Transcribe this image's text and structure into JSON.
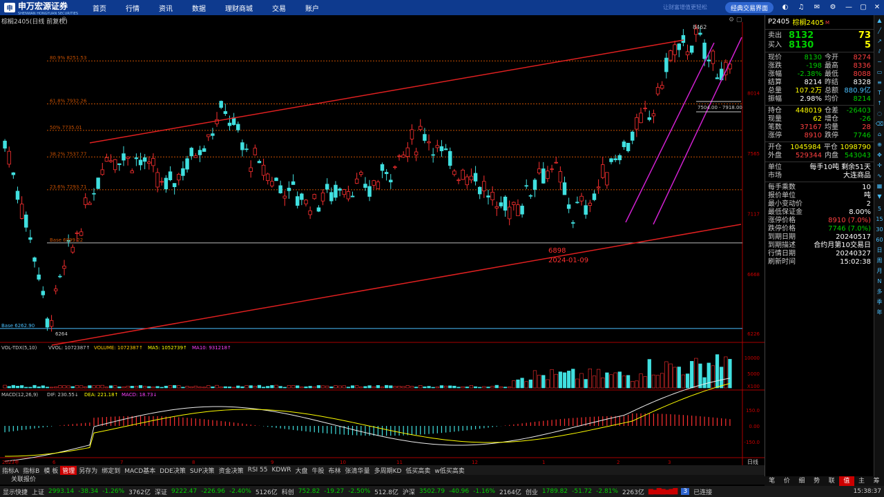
{
  "topbar": {
    "brand": "申万宏源证券",
    "brand_en": "SHENWAN HONGYUAN SECURITIES",
    "nav": [
      "首页",
      "行情",
      "资讯",
      "数据",
      "理财商城",
      "交易",
      "账户"
    ],
    "slogan": "让财富增值更轻松",
    "classic_button": "经典交易界面"
  },
  "chart": {
    "title": "棕榈2405(日线 前复权)",
    "fib": [
      {
        "label": "80.9% 8251.53",
        "price": 8251.53
      },
      {
        "label": "61.8% 7932.26",
        "price": 7932.26
      },
      {
        "label": "50% 7735.01",
        "price": 7735.01
      },
      {
        "label": "38.2% 7537.77",
        "price": 7537.77
      },
      {
        "label": "23.6% 7293.71",
        "price": 7293.71
      },
      {
        "label": "Base 6899.22",
        "price": 6899.22
      }
    ],
    "base_low_label": "Base 6262.90",
    "price_axis": [
      "8014",
      "7565",
      "7117",
      "6668",
      "6226"
    ],
    "high_mark": "8462",
    "low_mark": "6264",
    "box_label": "7504.00 - 7918.00",
    "annot_price": "6898",
    "annot_date": "2024-01-09",
    "x_labels": [
      "2023年",
      "6",
      "7",
      "8",
      "9",
      "10",
      "11",
      "12",
      "1",
      "2",
      "3"
    ],
    "period": "日线"
  },
  "volume": {
    "title": "VOL-TDX(5,10)",
    "vvol": "VVOL: 1072387↑",
    "volume": "VOLUME: 1072387↑",
    "ma5": "MA5: 1052739↑",
    "ma10": "MA10: 931218↑",
    "axis": [
      "10000",
      "5000",
      "X100"
    ]
  },
  "macd": {
    "title": "MACD(12,26,9)",
    "dif": "DIF: 230.55↓",
    "dea": "DEA: 221.18↑",
    "macd": "MACD: 18.73↓",
    "axis": [
      "150.0",
      "0.00",
      "-150.0"
    ]
  },
  "panel": {
    "code": "P2405",
    "name": "棕榈2405",
    "sell_label": "卖出",
    "sell_price": "8132",
    "sell_vol": "73",
    "buy_label": "买入",
    "buy_price": "8130",
    "buy_vol": "5",
    "rows": [
      [
        "现价",
        "8130",
        "今开",
        "8274"
      ],
      [
        "涨跌",
        "-198",
        "最高",
        "8336"
      ],
      [
        "涨幅",
        "-2.38%",
        "最低",
        "8088"
      ],
      [
        "结算",
        "8214",
        "昨结",
        "8328"
      ],
      [
        "总量",
        "107.2万",
        "总额",
        "880.9亿"
      ],
      [
        "振幅",
        "2.98%",
        "均价",
        "8214"
      ],
      [
        "持仓",
        "448019",
        "仓差",
        "-26403"
      ],
      [
        "现量",
        "62",
        "增仓",
        "-26"
      ],
      [
        "笔数",
        "37167",
        "均量",
        "28"
      ],
      [
        "涨停",
        "8910",
        "跌停",
        "7746"
      ],
      [
        "开仓",
        "1045984",
        "平仓",
        "1098790"
      ],
      [
        "外盘",
        "529344",
        "内盘",
        "543043"
      ]
    ],
    "unit_label": "单位",
    "unit_value": "每手10吨",
    "remain": "剩余51天",
    "market_label": "市场",
    "market_value": "大连商品",
    "info": [
      [
        "每手乘数",
        "10"
      ],
      [
        "报价单位",
        "吨"
      ],
      [
        "最小变动价",
        "2"
      ],
      [
        "最低保证金",
        "8.00%"
      ],
      [
        "涨停价格",
        "8910 (7.0%)"
      ],
      [
        "跌停价格",
        "7746 (7.0%)"
      ],
      [
        "到期日期",
        "20240517"
      ],
      [
        "到期描述",
        "合约月第10交易日"
      ]
    ],
    "quote_date_label": "行情日期",
    "quote_date": "20240327",
    "refresh_label": "刷新时间",
    "refresh_time": "15:02:38"
  },
  "vtoolbar": [
    "5",
    "15",
    "30",
    "60",
    "日",
    "周",
    "月",
    "N",
    "多",
    "季",
    "年"
  ],
  "bottom_tabs": [
    "指标A",
    "指标B",
    "模 板",
    "管理",
    "另存为",
    "绑定到",
    "MACD基本",
    "DDE决策",
    "SUP决策",
    "资金决策",
    "RSI 55",
    "KDWR",
    "大盘",
    "牛股",
    "布林",
    "张清华量",
    "多周期KD",
    "低买高卖",
    "w低买高卖"
  ],
  "related": "关联报价",
  "right_tabs": [
    "笔",
    "价",
    "细",
    "势",
    "联",
    "值",
    "主",
    "筹"
  ],
  "status": {
    "show": "显示快捷",
    "sh": "上证",
    "sh_v": "2993.14",
    "sh_c": "-38.34",
    "sh_p": "-1.26%",
    "sh_amt": "3762亿",
    "sz": "深证",
    "sz_v": "9222.47",
    "sz_c": "-226.96",
    "sz_p": "-2.40%",
    "sz_amt": "5126亿",
    "kc": "科创",
    "kc_v": "752.82",
    "kc_c": "-19.27",
    "kc_p": "-2.50%",
    "kc_amt": "512.8亿",
    "hs": "沪深",
    "hs_v": "3502.79",
    "hs_c": "-40.96",
    "hs_p": "-1.16%",
    "hs_amt": "2164亿",
    "cy": "创业",
    "cy_v": "1789.82",
    "cy_c": "-51.72",
    "cy_p": "-2.81%",
    "cy_amt": "2263亿",
    "badge": "3",
    "connected": "已连接",
    "time": "15:38:37"
  }
}
